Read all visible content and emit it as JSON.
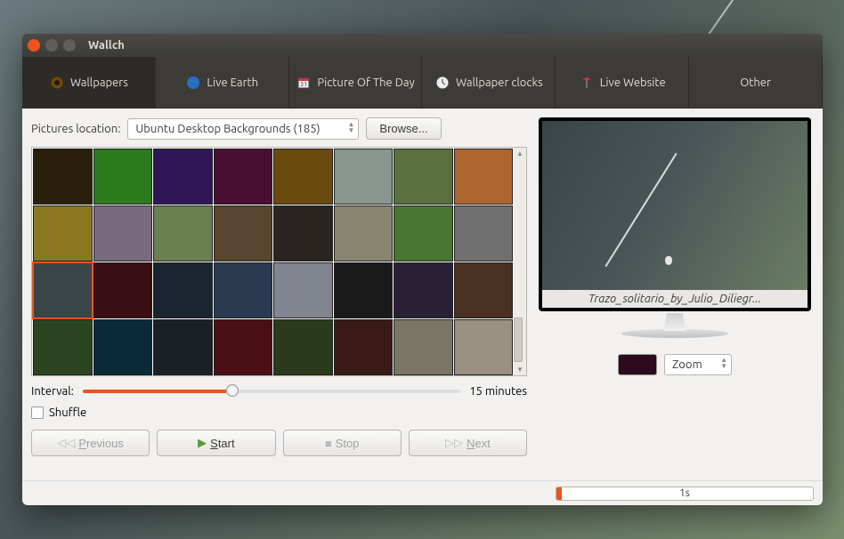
{
  "window": {
    "title": "Wallch"
  },
  "tabs": [
    {
      "label": "Wallpapers",
      "icon": "wallpaper-icon"
    },
    {
      "label": "Live Earth",
      "icon": "globe-icon"
    },
    {
      "label": "Picture Of The Day",
      "icon": "calendar-icon"
    },
    {
      "label": "Wallpaper clocks",
      "icon": "clock-icon"
    },
    {
      "label": "Live Website",
      "icon": "antenna-icon"
    },
    {
      "label": "Other",
      "icon": ""
    }
  ],
  "location": {
    "label": "Pictures location:",
    "selected": "Ubuntu Desktop Backgrounds (185)",
    "browse": "Browse..."
  },
  "thumbnails": [
    {
      "c": "#2a1f0a"
    },
    {
      "c": "#2d7a1e"
    },
    {
      "c": "#30175a"
    },
    {
      "c": "#4a0f30"
    },
    {
      "c": "#6b4a10"
    },
    {
      "c": "#8a9590"
    },
    {
      "c": "#5a7040"
    },
    {
      "c": "#b06530"
    },
    {
      "c": "#8a7820"
    },
    {
      "c": "#7a6a80"
    },
    {
      "c": "#6a8050"
    },
    {
      "c": "#5a4530"
    },
    {
      "c": "#2a2520"
    },
    {
      "c": "#8a8570"
    },
    {
      "c": "#4a7530"
    },
    {
      "c": "#707070"
    },
    {
      "c": "#3a4548",
      "sel": true
    },
    {
      "c": "#3a0f15"
    },
    {
      "c": "#1a2530"
    },
    {
      "c": "#2a3a50"
    },
    {
      "c": "#808590"
    },
    {
      "c": "#1a1a1a"
    },
    {
      "c": "#2a2035"
    },
    {
      "c": "#4a3020"
    },
    {
      "c": "#2a4520"
    },
    {
      "c": "#0a2a3a"
    },
    {
      "c": "#1a2025"
    },
    {
      "c": "#4a1015"
    },
    {
      "c": "#2a3a1a"
    },
    {
      "c": "#3a1a15"
    },
    {
      "c": "#7a7565"
    },
    {
      "c": "#9a9080"
    }
  ],
  "interval": {
    "label": "Interval:",
    "value": "15 minutes"
  },
  "shuffle": {
    "label": "Shuffle",
    "checked": false
  },
  "controls": {
    "previous": "Previous",
    "start": "Start",
    "stop": "Stop",
    "next": "Next"
  },
  "preview": {
    "caption": "Trazo_solitario_by_Julio_Diliegr..."
  },
  "fit": {
    "mode": "Zoom",
    "color": "#2d0a1e"
  },
  "progress": {
    "text": "1s"
  }
}
